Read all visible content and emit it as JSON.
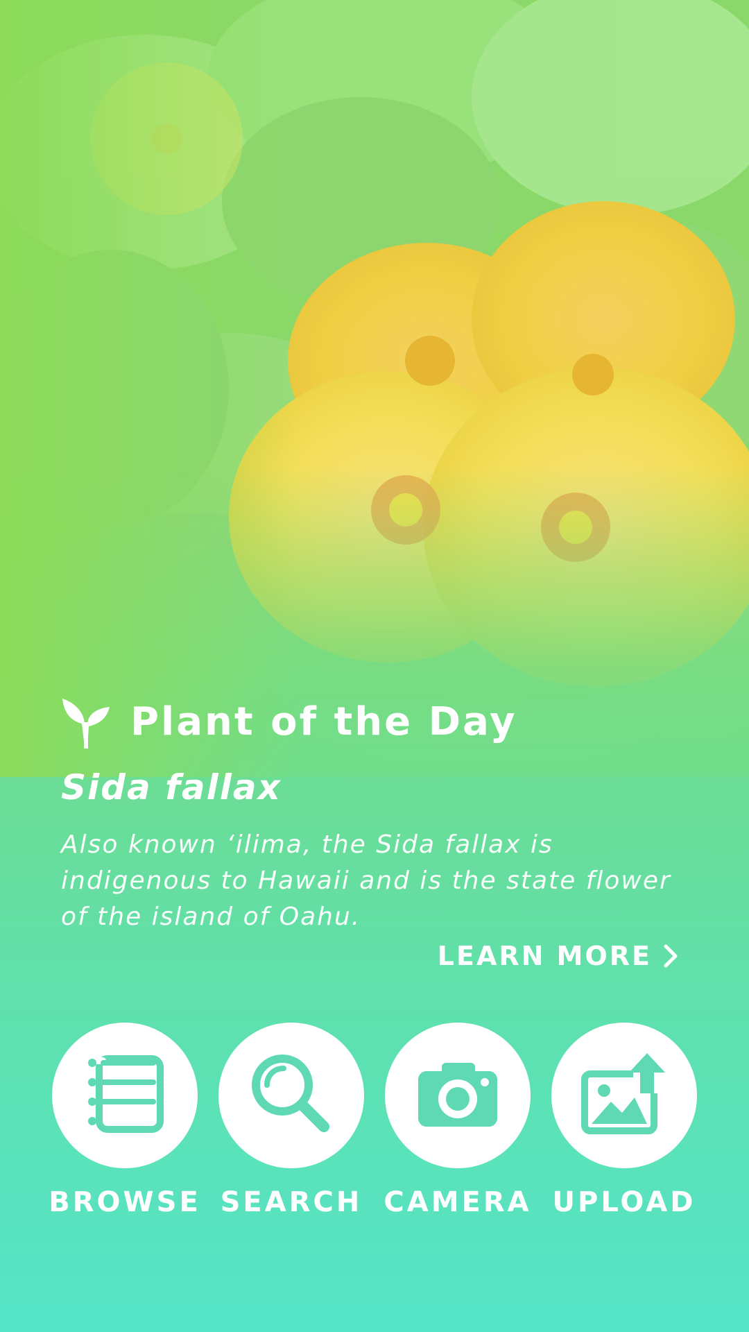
{
  "hero": {
    "image_subject": "yellow ilima flowers with green leaves"
  },
  "plant_of_day": {
    "heading": "Plant of the Day",
    "icon": "sprout-icon",
    "name": "Sida fallax",
    "description": "Also known ʻilima, the Sida fallax is indigenous to Hawaii and is the state flower of the island of Oahu.",
    "learn_more_label": "LEARN MORE",
    "learn_more_icon": "chevron-right-icon"
  },
  "actions": [
    {
      "label": "BROWSE",
      "icon": "list-icon"
    },
    {
      "label": "SEARCH",
      "icon": "search-icon"
    },
    {
      "label": "CAMERA",
      "icon": "camera-icon"
    },
    {
      "label": "UPLOAD",
      "icon": "upload-image-icon"
    }
  ],
  "colors": {
    "gradient_top": "#8cdc58",
    "gradient_bottom": "#55e4c8",
    "icon_teal": "#5ed9b4",
    "text": "#ffffff"
  }
}
